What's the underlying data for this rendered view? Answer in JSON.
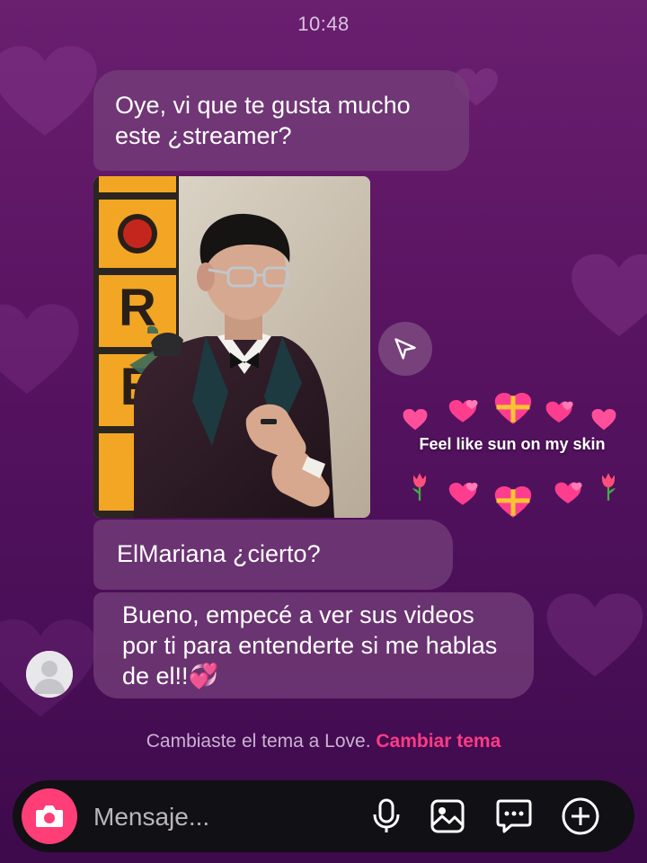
{
  "status": {
    "time": "10:48"
  },
  "messages": [
    {
      "text": "Oye, vi que te gusta mucho este ¿streamer?"
    },
    {
      "text": "ElMariana ¿cierto?"
    },
    {
      "text": "Bueno, empecé a ver sus videos por ti para entenderte si me hablas de el!!💞"
    }
  ],
  "shared_post": {
    "sign_letters": [
      "R",
      "E",
      "M"
    ]
  },
  "sticker": {
    "text": "Feel like sun on my skin"
  },
  "theme_notice": {
    "text": "Cambiaste el tema a Love.",
    "link": "Cambiar tema"
  },
  "composer": {
    "placeholder": "Mensaje..."
  },
  "icons": {
    "share": "send-icon",
    "camera": "camera-icon",
    "mic": "microphone-icon",
    "gallery": "gallery-icon",
    "sticker": "sticker-chat-icon",
    "add": "plus-icon",
    "avatar": "avatar-icon"
  },
  "colors": {
    "accent": "#ff3a86",
    "camera": "#ff3e77",
    "bubble": "#733e78",
    "background": "#5a1462"
  }
}
